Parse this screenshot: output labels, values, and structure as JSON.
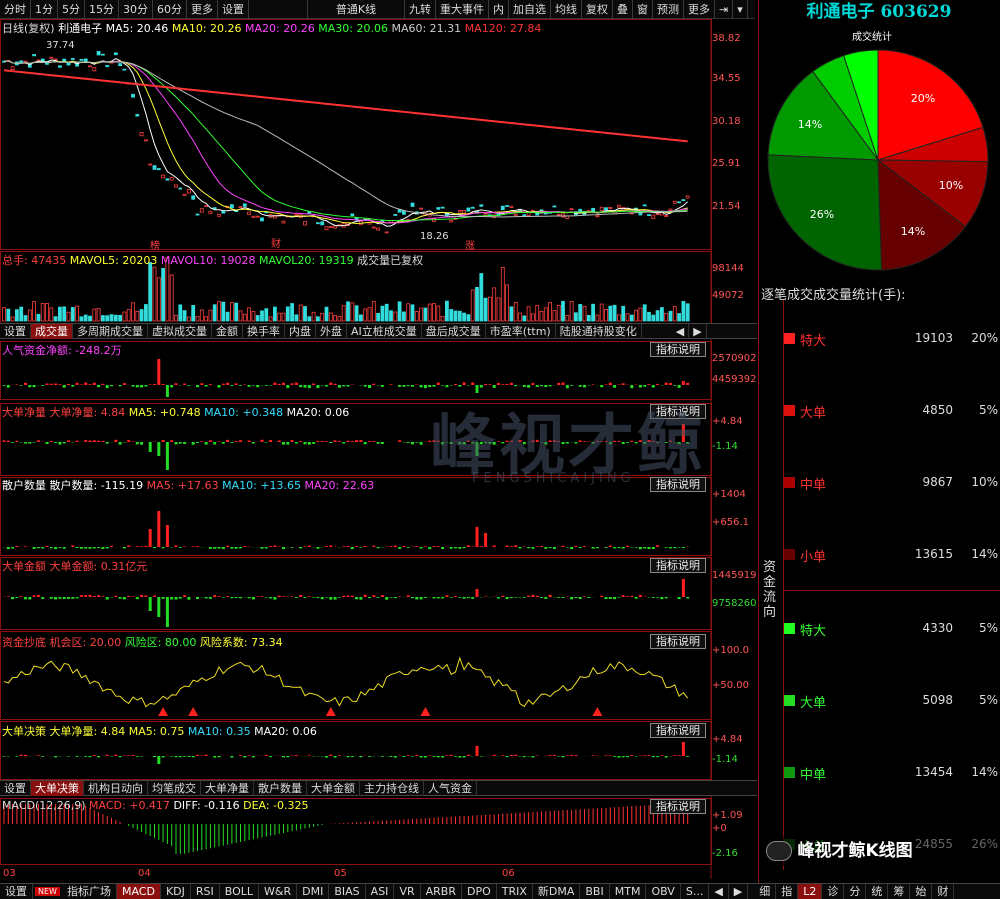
{
  "toolbar": {
    "items": [
      "分时",
      "1分",
      "5分",
      "15分",
      "30分",
      "60分",
      "更多",
      "设置"
    ],
    "kline": "普通K线",
    "tools": [
      "九转",
      "重大事件",
      "内",
      "加自选",
      "均线",
      "复权",
      "叠",
      "窗",
      "预测",
      "更多"
    ]
  },
  "stock": {
    "title": "利通电子 603629",
    "name": "利通电子",
    "period": "日线(复权)",
    "high_label": "37.74",
    "low_label": "18.26"
  },
  "ma": {
    "ma5": "MA5: 20.46",
    "ma10": "MA10: 20.26",
    "ma20": "MA20: 20.26",
    "ma30": "MA30: 20.06",
    "ma60": "MA60: 21.31",
    "ma120": "MA120: 27.84"
  },
  "price_axis": [
    "38.82",
    "34.55",
    "30.18",
    "25.91",
    "21.54"
  ],
  "markers": [
    "榜",
    "财",
    "涨"
  ],
  "volume": {
    "total": "总手: 47435",
    "mavol5": "MAVOL5: 20203",
    "mavol10": "MAVOL10: 19028",
    "mavol20": "MAVOL20: 19319",
    "note": "成交量已复权",
    "axis": [
      "98144",
      "49072"
    ]
  },
  "tabs1": [
    "设置",
    "成交量",
    "多周期成交量",
    "虚拟成交量",
    "金额",
    "换手率",
    "内盘",
    "外盘",
    "AI立桩成交量",
    "盘后成交量",
    "市盈率(ttm)",
    "陆股通持股变化"
  ],
  "ind_btn": "指标说明",
  "panels": {
    "p1": {
      "label": "人气资金净额: -248.2万",
      "axis": [
        "2570902",
        "4459392"
      ]
    },
    "p2": {
      "label": "大单净量 大单净量: 4.84",
      "ma5": "MA5: +0.748",
      "ma10": "MA10: +0.348",
      "ma20": "MA20: 0.06",
      "axis": [
        "+4.84",
        "-1.14"
      ]
    },
    "p3": {
      "label": "散户数量 散户数量: -115.19",
      "ma5": "MA5: +17.63",
      "ma10": "MA10: +13.65",
      "ma20": "MA20: 22.63",
      "axis": [
        "+1404",
        "+656.1"
      ]
    },
    "p4": {
      "label": "大单金额 大单金额: 0.31亿元",
      "axis": [
        "1445919",
        "9758260"
      ]
    },
    "p5": {
      "label": "资金抄底 机会区: 20.00",
      "chance": "风险区: 80.00",
      "risk": "风险系数: 73.34",
      "axis": [
        "+100.0",
        "+50.00"
      ]
    },
    "p6": {
      "label": "大单决策 大单净量: 4.84",
      "ma5": "MA5: 0.75",
      "ma10": "MA10: 0.35",
      "ma20": "MA20: 0.06",
      "axis": [
        "+4.84",
        "-1.14"
      ]
    },
    "p7": {
      "label": "MACD(12,26,9)",
      "macd": "MACD: +0.417",
      "diff": "DIFF: -0.116",
      "dea": "DEA: -0.325",
      "axis": [
        "+1.09",
        "+0",
        "-2.16"
      ]
    }
  },
  "tabs2": [
    "设置",
    "大单决策",
    "机构日动向",
    "均笔成交",
    "大单净量",
    "散户数量",
    "大单金额",
    "主力持仓线",
    "人气资金"
  ],
  "months": [
    "03",
    "04",
    "05",
    "06"
  ],
  "watermark": {
    "cn": "峰视才鲸",
    "en": "FENGSHICAIJING",
    "bottom": "峰视才鲸K线图"
  },
  "bottom_tabs": [
    "设置",
    "NEW",
    "指标广场",
    "MACD",
    "KDJ",
    "RSI",
    "BOLL",
    "W&R",
    "DMI",
    "BIAS",
    "ASI",
    "VR",
    "ARBR",
    "DPO",
    "TRIX",
    "新DMA",
    "BBI",
    "MTM",
    "OBV",
    "S..."
  ],
  "right_tabs": [
    "细",
    "指",
    "L2",
    "诊",
    "分",
    "统",
    "筹",
    "始",
    "财"
  ],
  "pie_title": "成交统计",
  "chart_data": {
    "type": "pie",
    "title": "成交统计",
    "slices": [
      {
        "name": "特大(买)",
        "value": 20,
        "color": "#ff0000"
      },
      {
        "name": "大单(买)",
        "value": 5,
        "color": "#cc0000"
      },
      {
        "name": "中单(买)",
        "value": 10,
        "color": "#990000"
      },
      {
        "name": "小单(买)",
        "value": 14,
        "color": "#660000"
      },
      {
        "name": "小单(卖)",
        "value": 26,
        "color": "#006400"
      },
      {
        "name": "中单(卖)",
        "value": 14,
        "color": "#009900"
      },
      {
        "name": "大单(卖)",
        "value": 5,
        "color": "#00cc00"
      },
      {
        "name": "特大(卖)",
        "value": 5,
        "color": "#00ff00"
      }
    ],
    "labels": [
      "20%",
      "10%",
      "14%",
      "26%",
      "14%"
    ]
  },
  "stats_title": "逐笔成交成交量统计(手):",
  "side_label": "资金流向",
  "rows": [
    {
      "name": "特大",
      "v": "19103",
      "p": "20%",
      "c": "#ff2020",
      "t": "#ff3030"
    },
    {
      "name": "大单",
      "v": "4850",
      "p": "5%",
      "c": "#dd1010",
      "t": "#ff3030"
    },
    {
      "name": "中单",
      "v": "9867",
      "p": "10%",
      "c": "#aa0000",
      "t": "#ff3030"
    },
    {
      "name": "小单",
      "v": "13615",
      "p": "14%",
      "c": "#660000",
      "t": "#ff3030"
    },
    {
      "name": "特大",
      "v": "4330",
      "p": "5%",
      "c": "#22ff22",
      "t": "#33ff33"
    },
    {
      "name": "大单",
      "v": "5098",
      "p": "5%",
      "c": "#22dd22",
      "t": "#33ff33"
    },
    {
      "name": "中单",
      "v": "13454",
      "p": "14%",
      "c": "#119911",
      "t": "#33ff33"
    },
    {
      "name": "小单",
      "v": "24855",
      "p": "26%",
      "c": "#0a5a0a",
      "t": "#33ff33"
    }
  ]
}
